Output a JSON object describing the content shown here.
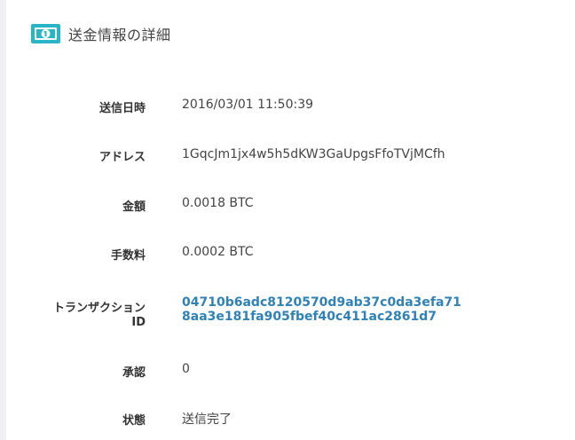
{
  "colors": {
    "accent": "#29b5c8",
    "link": "#2e82b8",
    "text": "#333333",
    "strip": "#eef0f1"
  },
  "header": {
    "icon": "banknote-icon",
    "title": "送金情報の詳細"
  },
  "details": {
    "sent_at_label": "送信日時",
    "sent_at": "2016/03/01 11:50:39",
    "address_label": "アドレス",
    "address": "1GqcJm1jx4w5h5dKW3GaUpgsFfoTVjMCfh",
    "amount_label": "金額",
    "amount": "0.0018 BTC",
    "fee_label": "手数料",
    "fee": "0.0002 BTC",
    "txid_label_line1": "トランザクション",
    "txid_label_line2": "ID",
    "txid_line1": "04710b6adc8120570d9ab37c0da3efa71",
    "txid_line2": "8aa3e181fa905fbef40c411ac2861d7",
    "confirmations_label": "承認",
    "confirmations": "0",
    "status_label": "状態",
    "status": "送信完了"
  }
}
